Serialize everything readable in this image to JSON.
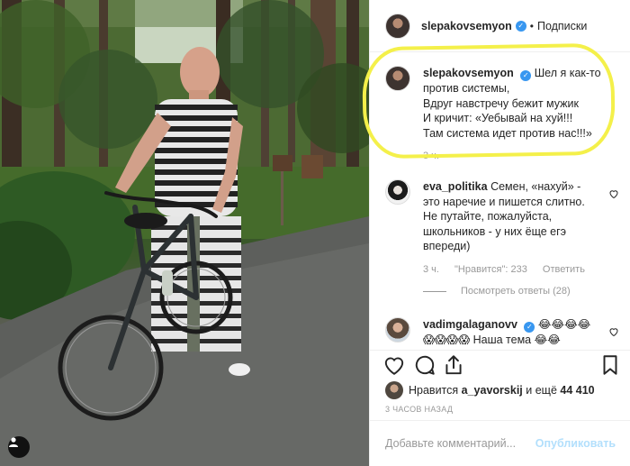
{
  "post": {
    "photo_alt": "",
    "header": {
      "username": "slepakovsemyon",
      "separator": "•",
      "follow_label": "Подписки"
    },
    "caption": {
      "username": "slepakovsemyon",
      "lines": [
        "Шел я как-то",
        "против системы,",
        "Вдруг навстречу бежит мужик",
        "И кричит: «Уебывай на хуй!!!",
        "Там система идет против нас!!!»"
      ],
      "time": "3 ч."
    },
    "comments": [
      {
        "username": "eva_politika",
        "lines": [
          "Семен, «нахуй» -",
          "это наречие и пишется слитно.",
          "Не путайте, пожалуйста,",
          "школьников - у них ёще егэ",
          "впереди)"
        ],
        "time": "3 ч.",
        "likes": "\"Нравится\": 233",
        "reply": "Ответить",
        "view_replies": "Посмотреть ответы (28)"
      },
      {
        "username": "vadimgalaganovv",
        "emoji_line1": "😂😂😂😂",
        "emoji_line2": "😱😱😱😱",
        "text_end": "Наша тема 😂😂"
      }
    ],
    "likes_text_prefix": "Нравится",
    "likes_user": "a_yavorskij",
    "likes_text_and": "и ещё",
    "likes_count": "44 410",
    "time_ago": "3 ЧАСОВ НАЗАД",
    "comment_input": {
      "placeholder": "Добавьте комментарий...",
      "submit": "Опубликовать"
    },
    "icons": {
      "like": "heart-icon",
      "comment": "comment-icon",
      "share": "share-icon",
      "save": "bookmark-icon",
      "tag": "user-tag-icon",
      "verified": "verified-badge-icon"
    },
    "colors": {
      "verified": "#3897f0",
      "highlight": "#f4f04a",
      "publish_disabled": "#b2dffc"
    }
  }
}
